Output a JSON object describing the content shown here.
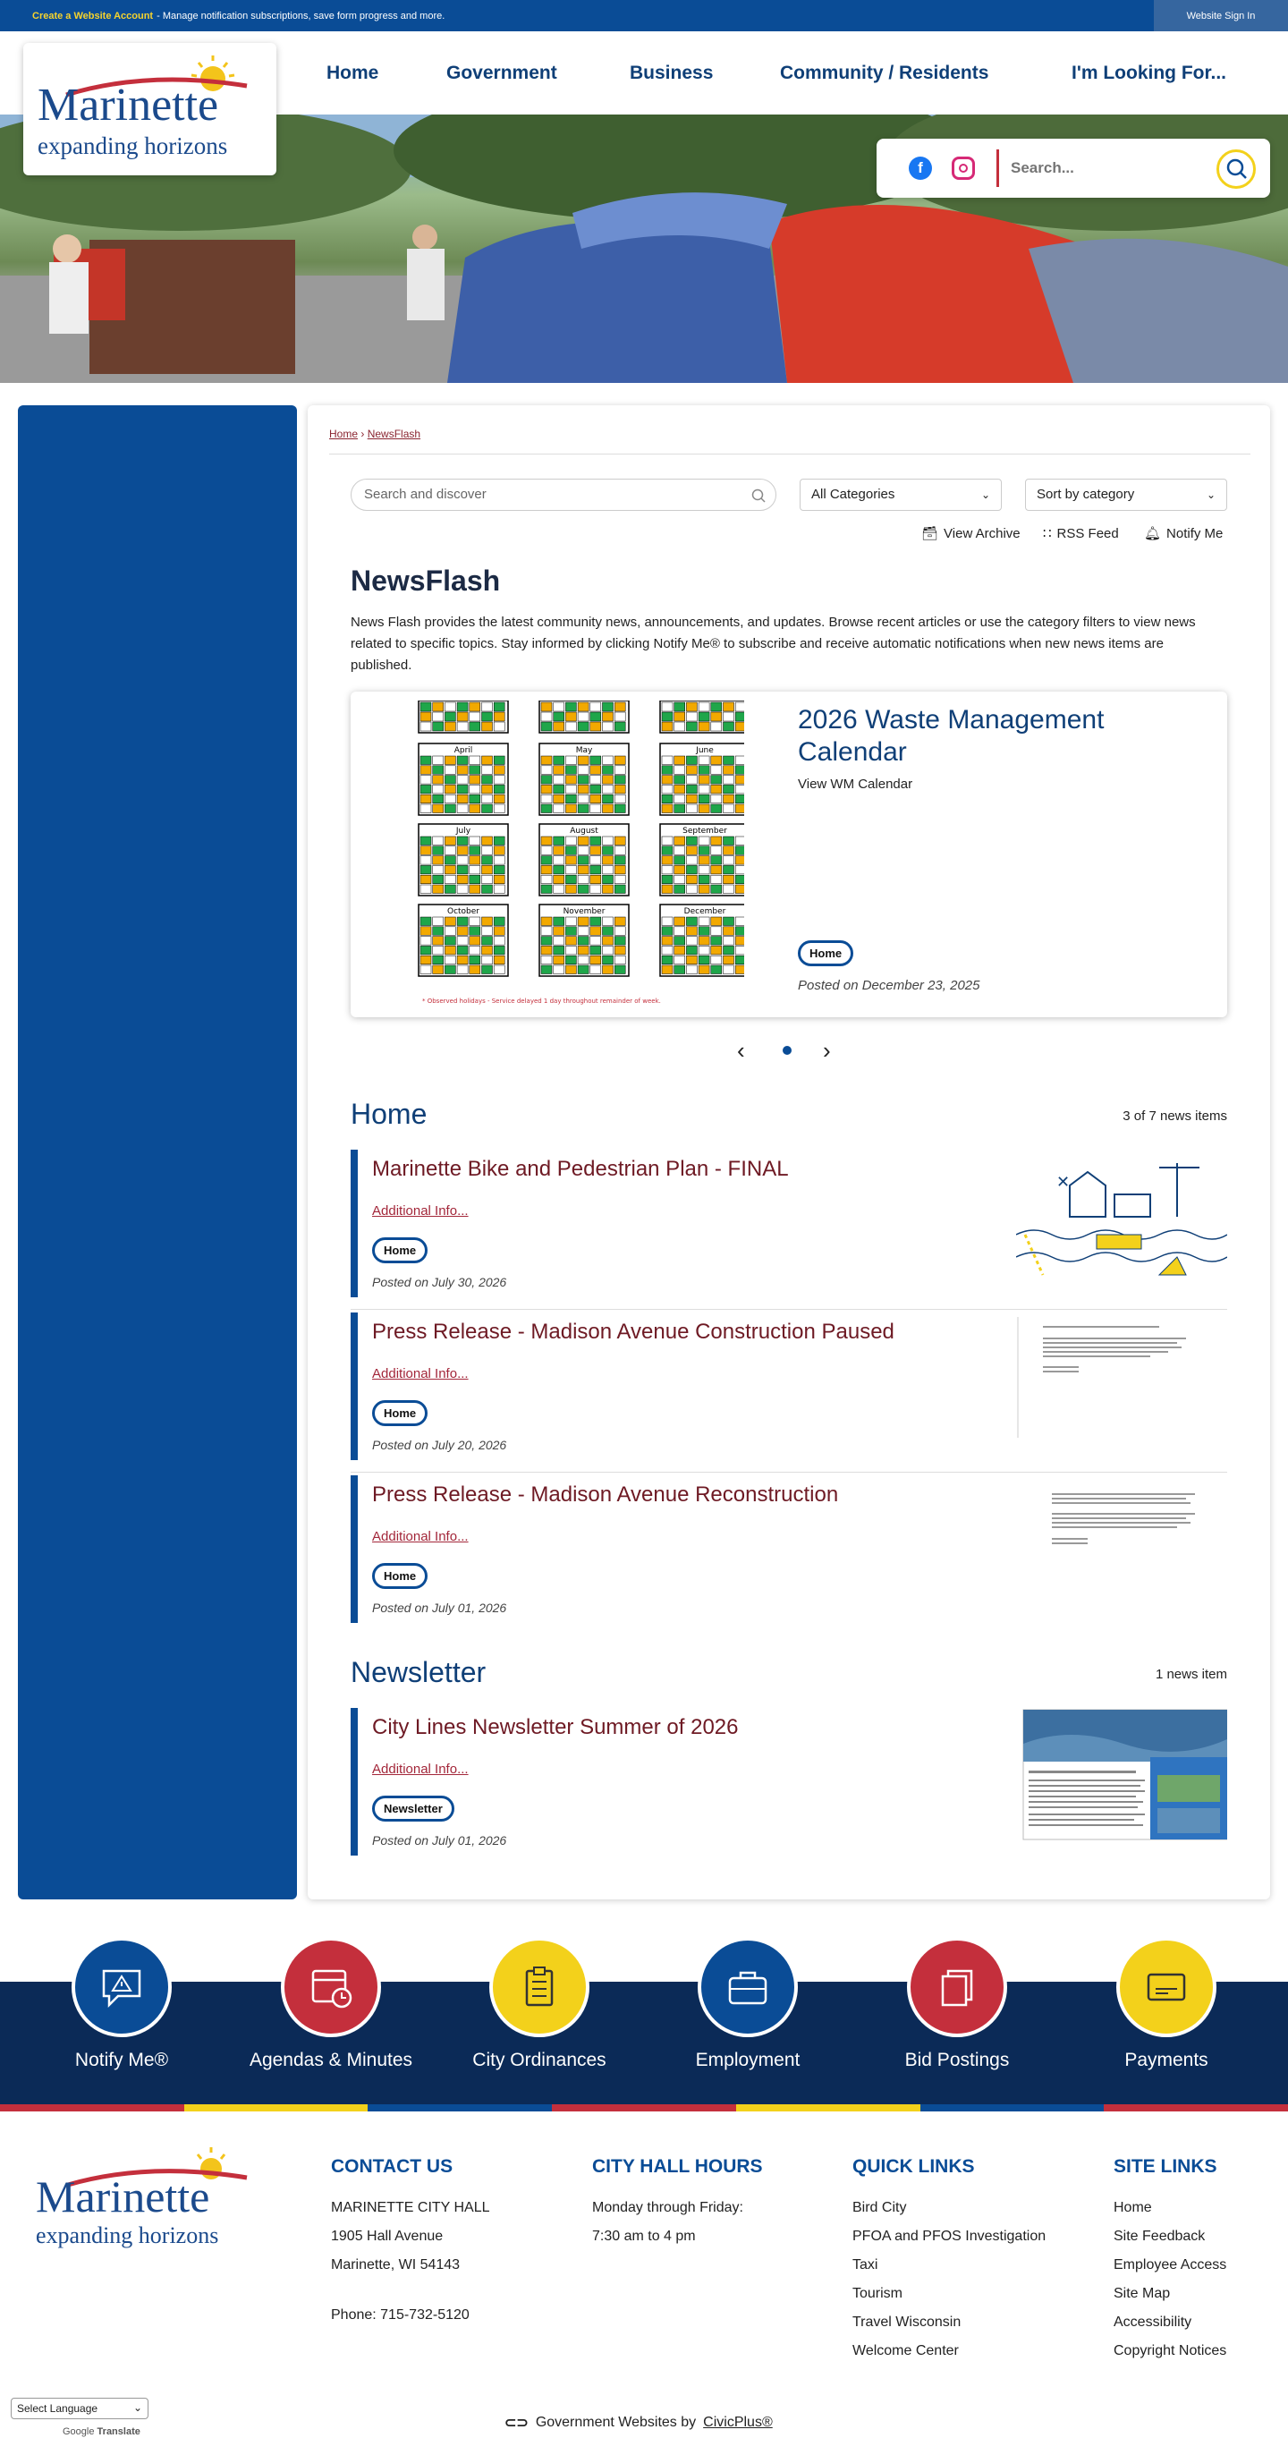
{
  "topbar": {
    "create_link": "Create a Website Account",
    "message": " - Manage notification subscriptions, save form progress and more.",
    "signin": "Website Sign In"
  },
  "logo": {
    "name": "Marinette",
    "tagline": "expanding horizons"
  },
  "nav": [
    "Home",
    "Government",
    "Business",
    "Community / Residents",
    "I'm Looking For..."
  ],
  "hero": {
    "search_placeholder": "Search..."
  },
  "breadcrumb": {
    "home": "Home",
    "current": "NewsFlash"
  },
  "filters": {
    "search_placeholder": "Search and discover",
    "category": "All Categories",
    "sort": "Sort by category"
  },
  "tools": {
    "archive": "View Archive",
    "rss": "RSS Feed",
    "notify": "Notify Me"
  },
  "page": {
    "title": "NewsFlash",
    "intro": "News Flash provides the latest community news, announcements, and updates. Browse recent articles or use the category filters to view news related to specific topics. Stay informed by clicking Notify Me® to subscribe and receive automatic notifications when new news items are published."
  },
  "featured": {
    "title": "2026 Waste Management Calendar",
    "link": "View WM Calendar",
    "tag": "Home",
    "date": "Posted on December 23, 2025",
    "months": [
      "April",
      "May",
      "June",
      "July",
      "August",
      "September",
      "October",
      "November",
      "December"
    ],
    "note": "* Observed holidays - Service delayed 1 day throughout remainder of week."
  },
  "home_section": {
    "title": "Home",
    "count": "3 of 7 news items",
    "items": [
      {
        "title": "Marinette Bike and Pedestrian Plan - FINAL",
        "link": "Additional Info...",
        "tag": "Home",
        "date": "Posted on July 30, 2026"
      },
      {
        "title": "Press Release - Madison Avenue Construction Paused",
        "link": "Additional Info...",
        "tag": "Home",
        "date": "Posted on July 20, 2026"
      },
      {
        "title": "Press Release - Madison Avenue Reconstruction",
        "link": "Additional Info...",
        "tag": "Home",
        "date": "Posted on July 01, 2026"
      }
    ]
  },
  "newsletter_section": {
    "title": "Newsletter",
    "count": "1 news item",
    "items": [
      {
        "title": "City Lines Newsletter Summer of 2026",
        "link": "Additional Info...",
        "tag": "Newsletter",
        "date": "Posted on July 01, 2026"
      }
    ]
  },
  "quicklinks": [
    {
      "label": "Notify Me®",
      "icon": "alert-bubble-icon",
      "color": "#0a4c96"
    },
    {
      "label": "Agendas & Minutes",
      "icon": "calendar-clock-icon",
      "color": "#c42f3c"
    },
    {
      "label": "City Ordinances",
      "icon": "clipboard-icon",
      "color": "#f3d11b"
    },
    {
      "label": "Employment",
      "icon": "briefcase-icon",
      "color": "#0a4c96"
    },
    {
      "label": "Bid Postings",
      "icon": "documents-icon",
      "color": "#c42f3c"
    },
    {
      "label": "Payments",
      "icon": "card-icon",
      "color": "#f3d11b"
    }
  ],
  "footer": {
    "contact": {
      "heading": "CONTACT US",
      "lines": [
        "MARINETTE CITY HALL",
        "1905 Hall Avenue",
        "Marinette, WI 54143",
        "",
        "Phone: 715-732-5120"
      ]
    },
    "hours": {
      "heading": "CITY HALL HOURS",
      "lines": [
        "Monday through Friday:",
        "7:30 am to 4 pm"
      ]
    },
    "quick": {
      "heading": "QUICK LINKS",
      "lines": [
        "Bird City",
        "PFOA and PFOS Investigation",
        "Taxi",
        "Tourism",
        "Travel Wisconsin",
        "Welcome Center"
      ]
    },
    "site": {
      "heading": "SITE LINKS",
      "lines": [
        "Home",
        "Site Feedback",
        "Employee Access",
        "Site Map",
        "Accessibility",
        "Copyright Notices"
      ]
    },
    "language": "Select Language",
    "google": "Google",
    "translate": "Translate",
    "credit_prefix": "Government Websites by ",
    "credit_brand": "CivicPlus®"
  }
}
